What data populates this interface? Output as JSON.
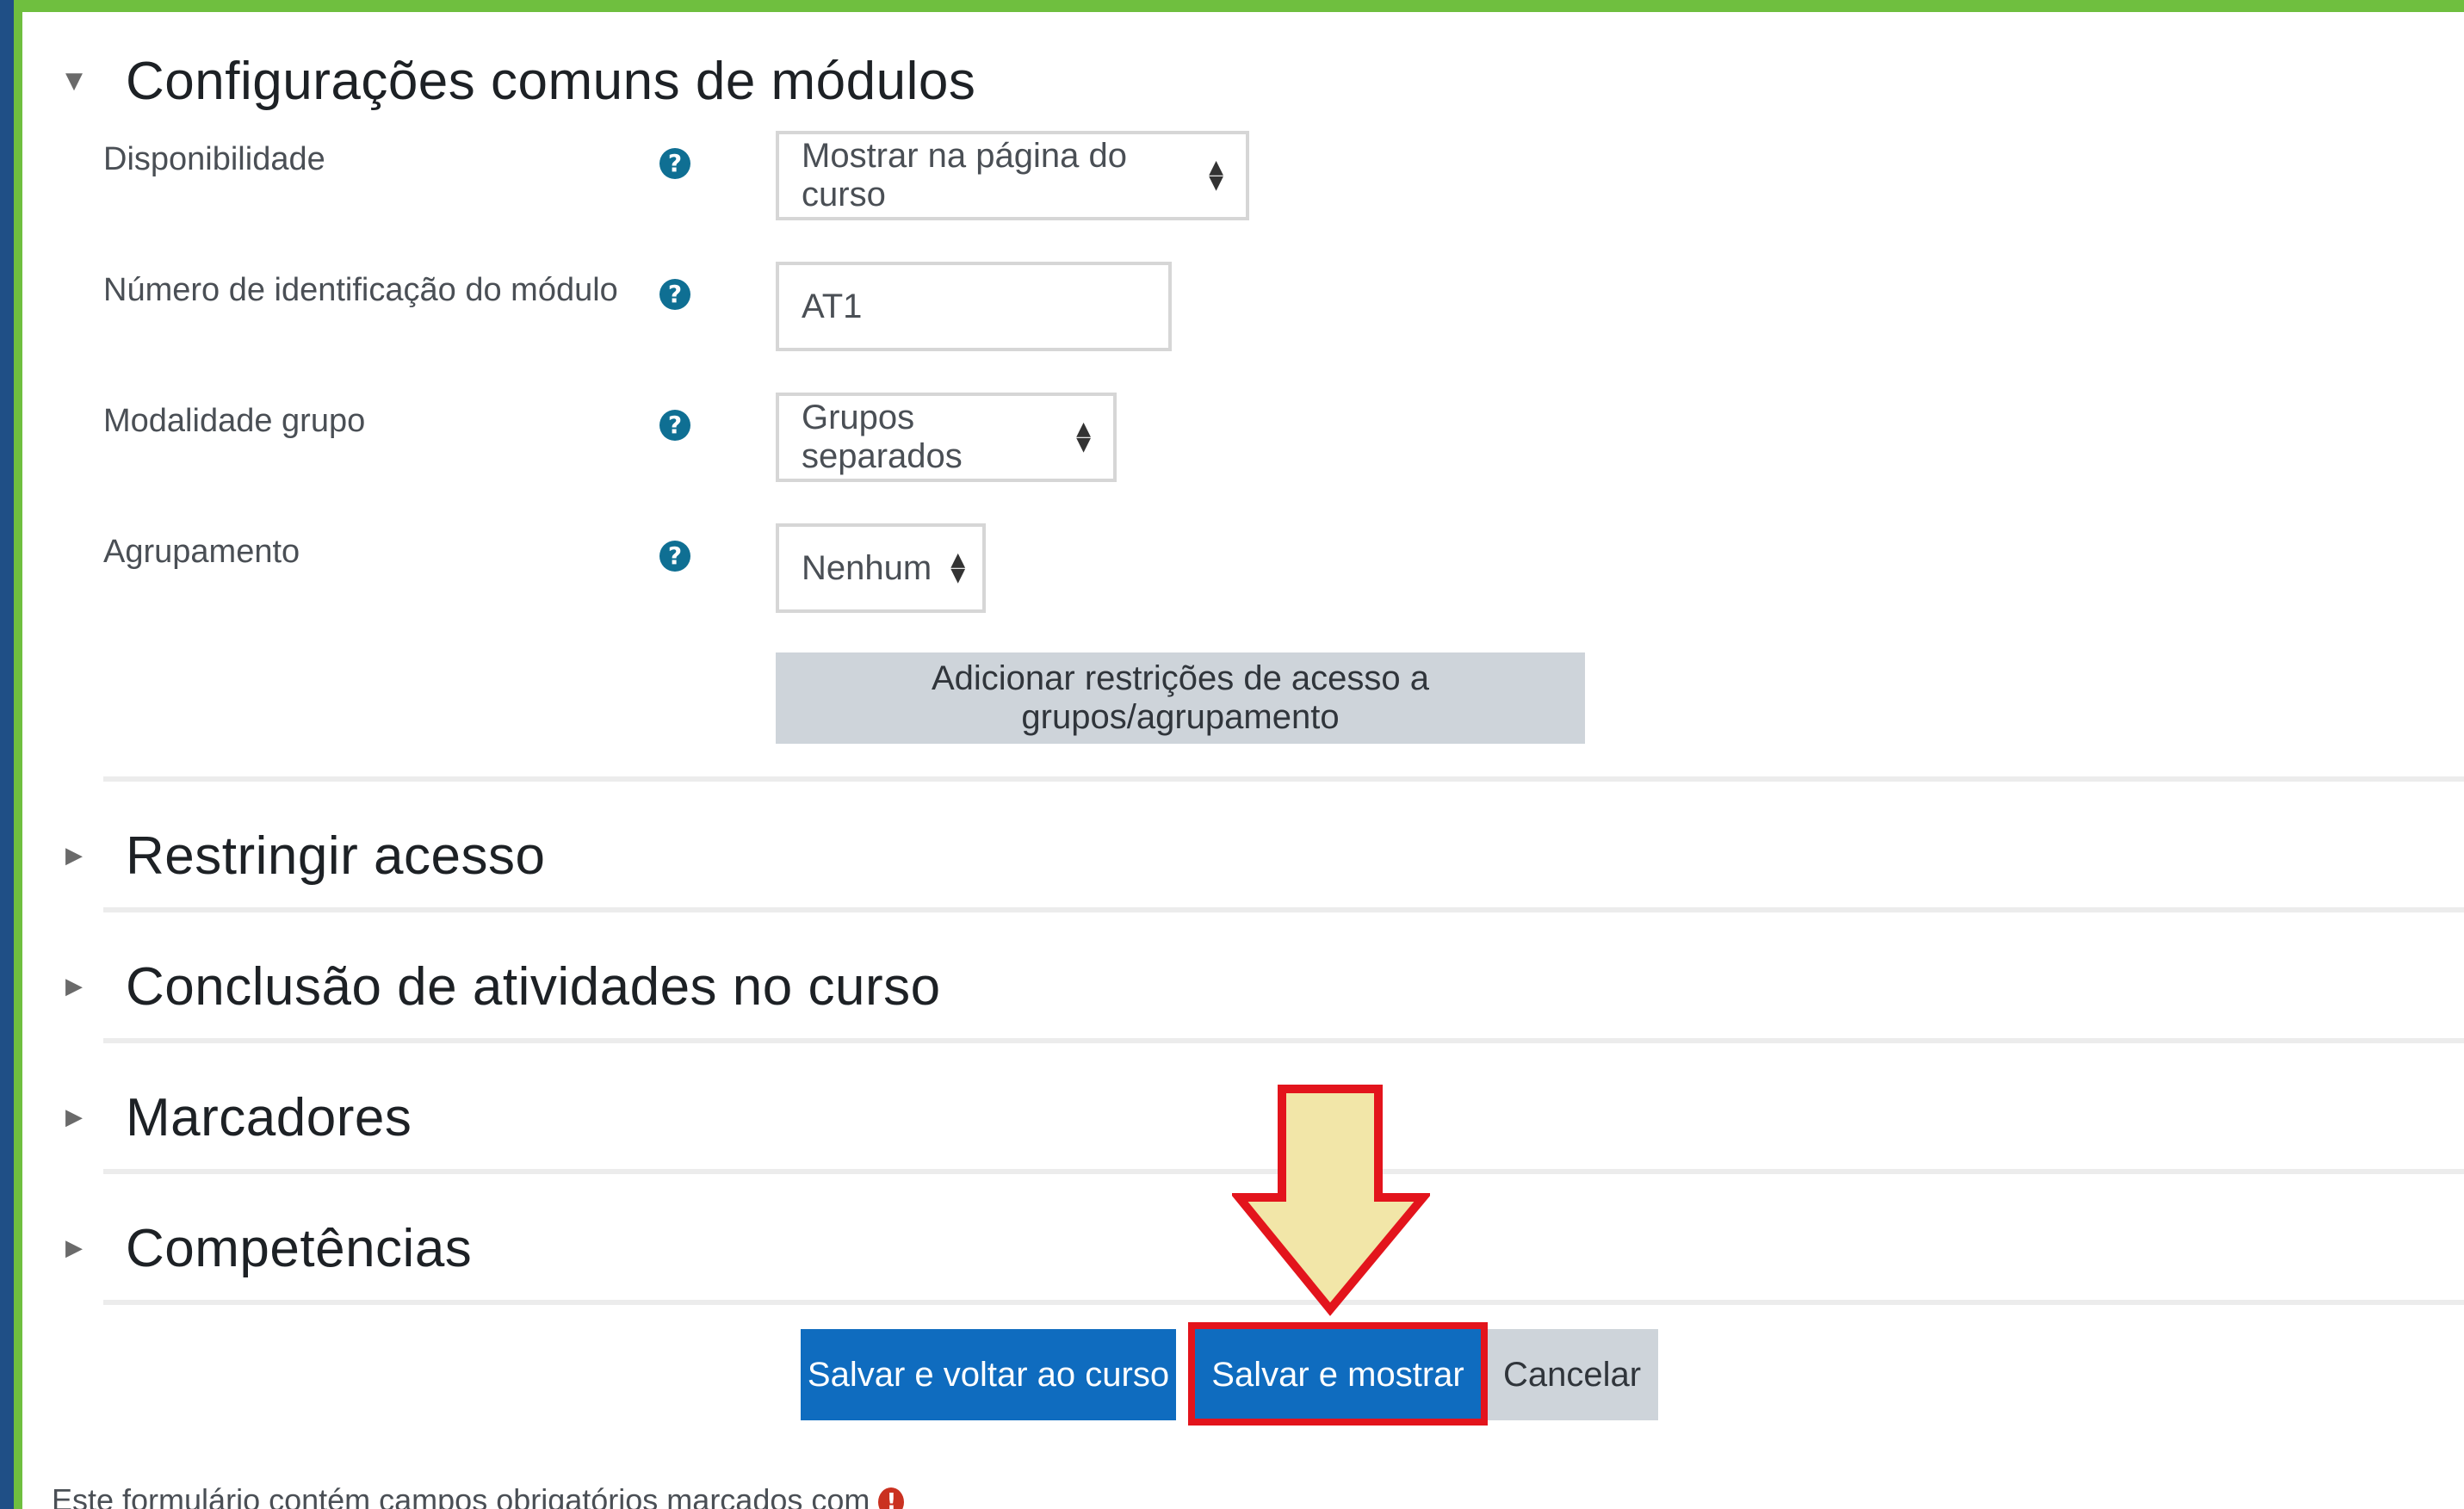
{
  "colors": {
    "outer_frame": "#1f4f86",
    "green_border": "#6fbf3f",
    "primary_button": "#0f6cbf",
    "secondary_button": "#ced4da",
    "help_icon": "#0f6f93",
    "highlight": "#e3141c",
    "arrow_fill": "#f2e6a8"
  },
  "module_settings": {
    "title": "Configurações comuns de módulos",
    "caret_icon": "caret-down-icon",
    "fields": {
      "availability": {
        "label": "Disponibilidade",
        "value": "Mostrar na página do curso"
      },
      "id_number": {
        "label": "Número de identificação do módulo",
        "value": "AT1"
      },
      "group_mode": {
        "label": "Modalidade grupo",
        "value": "Grupos separados"
      },
      "grouping": {
        "label": "Agrupamento",
        "value": "Nenhum"
      }
    },
    "add_restrictions_label": "Adicionar restrições de acesso a grupos/agrupamento"
  },
  "collapsed_sections": [
    {
      "title": "Restringir acesso"
    },
    {
      "title": "Conclusão de atividades no curso"
    },
    {
      "title": "Marcadores"
    },
    {
      "title": "Competências"
    }
  ],
  "buttons": {
    "save_return": "Salvar e voltar ao curso",
    "save_display": "Salvar e mostrar",
    "cancel": "Cancelar"
  },
  "footer_note": "Este formulário contém campos obrigatórios marcados com",
  "icons": {
    "help": "question-circle-icon",
    "required": "exclamation-circle-icon",
    "callout_arrow": "down-arrow-icon"
  }
}
